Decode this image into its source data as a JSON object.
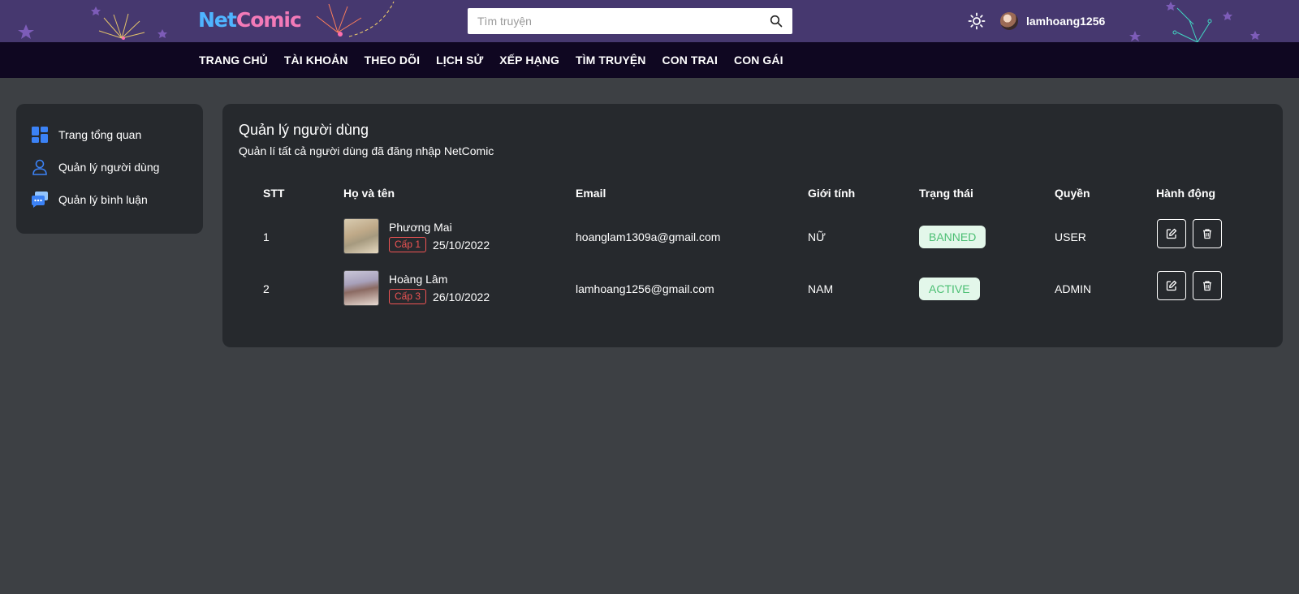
{
  "header": {
    "logo_part1": "Net",
    "logo_part2": "Comic",
    "search_placeholder": "Tìm truyện",
    "username": "lamhoang1256"
  },
  "nav": {
    "items": [
      "TRANG CHỦ",
      "TÀI KHOẢN",
      "THEO DÕI",
      "LỊCH SỬ",
      "XẾP HẠNG",
      "TÌM TRUYỆN",
      "CON TRAI",
      "CON GÁI"
    ]
  },
  "sidebar": {
    "items": [
      {
        "label": "Trang tổng quan",
        "icon": "dashboard-icon"
      },
      {
        "label": "Quản lý người dùng",
        "icon": "user-icon"
      },
      {
        "label": "Quản lý bình luận",
        "icon": "comment-icon"
      }
    ]
  },
  "main": {
    "title": "Quản lý người dùng",
    "subtitle": "Quản lí tất cả người dùng đã đăng nhập NetComic",
    "columns": [
      "STT",
      "Họ và tên",
      "Email",
      "Giới tính",
      "Trạng thái",
      "Quyền",
      "Hành động"
    ],
    "rows": [
      {
        "stt": "1",
        "name": "Phương Mai",
        "level": "Cấp 1",
        "date": "25/10/2022",
        "email": "hoanglam1309a@gmail.com",
        "gender": "NỮ",
        "status": "BANNED",
        "role": "USER"
      },
      {
        "stt": "2",
        "name": "Hoàng Lâm",
        "level": "Cấp 3",
        "date": "26/10/2022",
        "email": "lamhoang1256@gmail.com",
        "gender": "NAM",
        "status": "ACTIVE",
        "role": "ADMIN"
      }
    ]
  },
  "colors": {
    "header_bg": "#46386f",
    "nav_bg": "#0f0721",
    "page_bg": "#3d4044",
    "panel_bg": "#26292d",
    "level_red": "#f05454",
    "status_green": "#4bbf73"
  }
}
